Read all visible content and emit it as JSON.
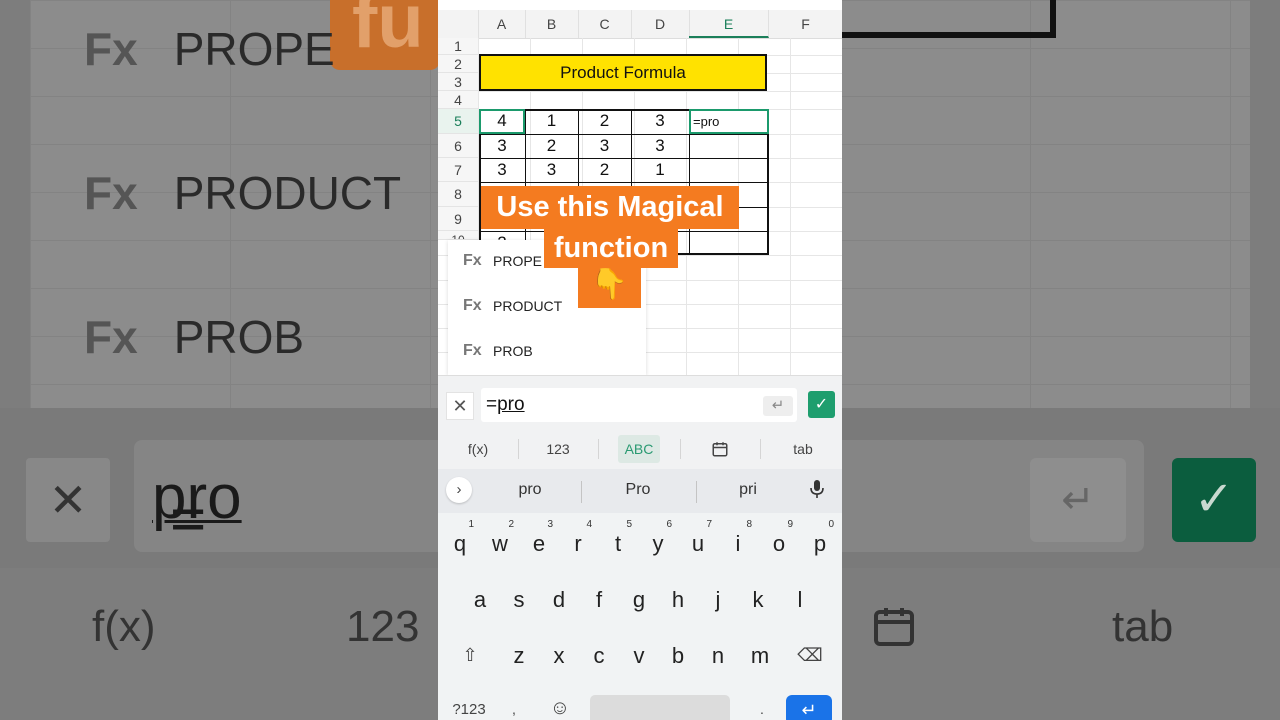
{
  "background": {
    "orange_text": "fu",
    "suggestions": [
      "PROPE",
      "PRODUCT",
      "PROB"
    ],
    "fx_label": "Fx",
    "formula_prefix": "=",
    "formula_typed": "pro",
    "tools": [
      "f(x)",
      "123",
      "tab"
    ]
  },
  "sheet": {
    "columns": [
      "A",
      "B",
      "C",
      "D",
      "E",
      "F"
    ],
    "selected_column": "E",
    "rows": [
      "1",
      "2",
      "3",
      "4",
      "5",
      "6",
      "7",
      "8",
      "9",
      "10"
    ],
    "title": "Product Formula",
    "data": [
      [
        "4",
        "1",
        "2",
        "3"
      ],
      [
        "3",
        "2",
        "3",
        "3"
      ],
      [
        "3",
        "3",
        "2",
        "1"
      ]
    ],
    "partial_cell": "2",
    "active_cell_value": "=pro"
  },
  "autocomplete": {
    "fx_label": "Fx",
    "items": [
      "PROPE",
      "PRODUCT",
      "PROB"
    ]
  },
  "overlay": {
    "line1": "Use this Magical",
    "line2": "function",
    "emoji": "👇",
    "color": "#f47b20"
  },
  "formula_bar": {
    "cancel_icon": "✕",
    "prefix": "=",
    "typed": "pro",
    "enter_icon": "↵",
    "confirm_icon": "✓"
  },
  "toolbar": {
    "fx": "f(x)",
    "num": "123",
    "abc": "ABC",
    "calendar_icon": "calendar-icon",
    "tab": "tab"
  },
  "keyboard": {
    "expand_icon": "›",
    "suggestions": [
      "pro",
      "Pro",
      "pri"
    ],
    "row1": [
      {
        "k": "q",
        "n": "1"
      },
      {
        "k": "w",
        "n": "2"
      },
      {
        "k": "e",
        "n": "3"
      },
      {
        "k": "r",
        "n": "4"
      },
      {
        "k": "t",
        "n": "5"
      },
      {
        "k": "y",
        "n": "6"
      },
      {
        "k": "u",
        "n": "7"
      },
      {
        "k": "i",
        "n": "8"
      },
      {
        "k": "o",
        "n": "9"
      },
      {
        "k": "p",
        "n": "0"
      }
    ],
    "row2": [
      "a",
      "s",
      "d",
      "f",
      "g",
      "h",
      "j",
      "k",
      "l"
    ],
    "row3": [
      "z",
      "x",
      "c",
      "v",
      "b",
      "n",
      "m"
    ],
    "symbols": "?123",
    "emoji_icon": "☺",
    "comma": ",",
    "period": ".",
    "enter_icon": "↵",
    "shift_icon": "⇧",
    "backspace_icon": "⌫",
    "mic_icon": "🎙"
  }
}
